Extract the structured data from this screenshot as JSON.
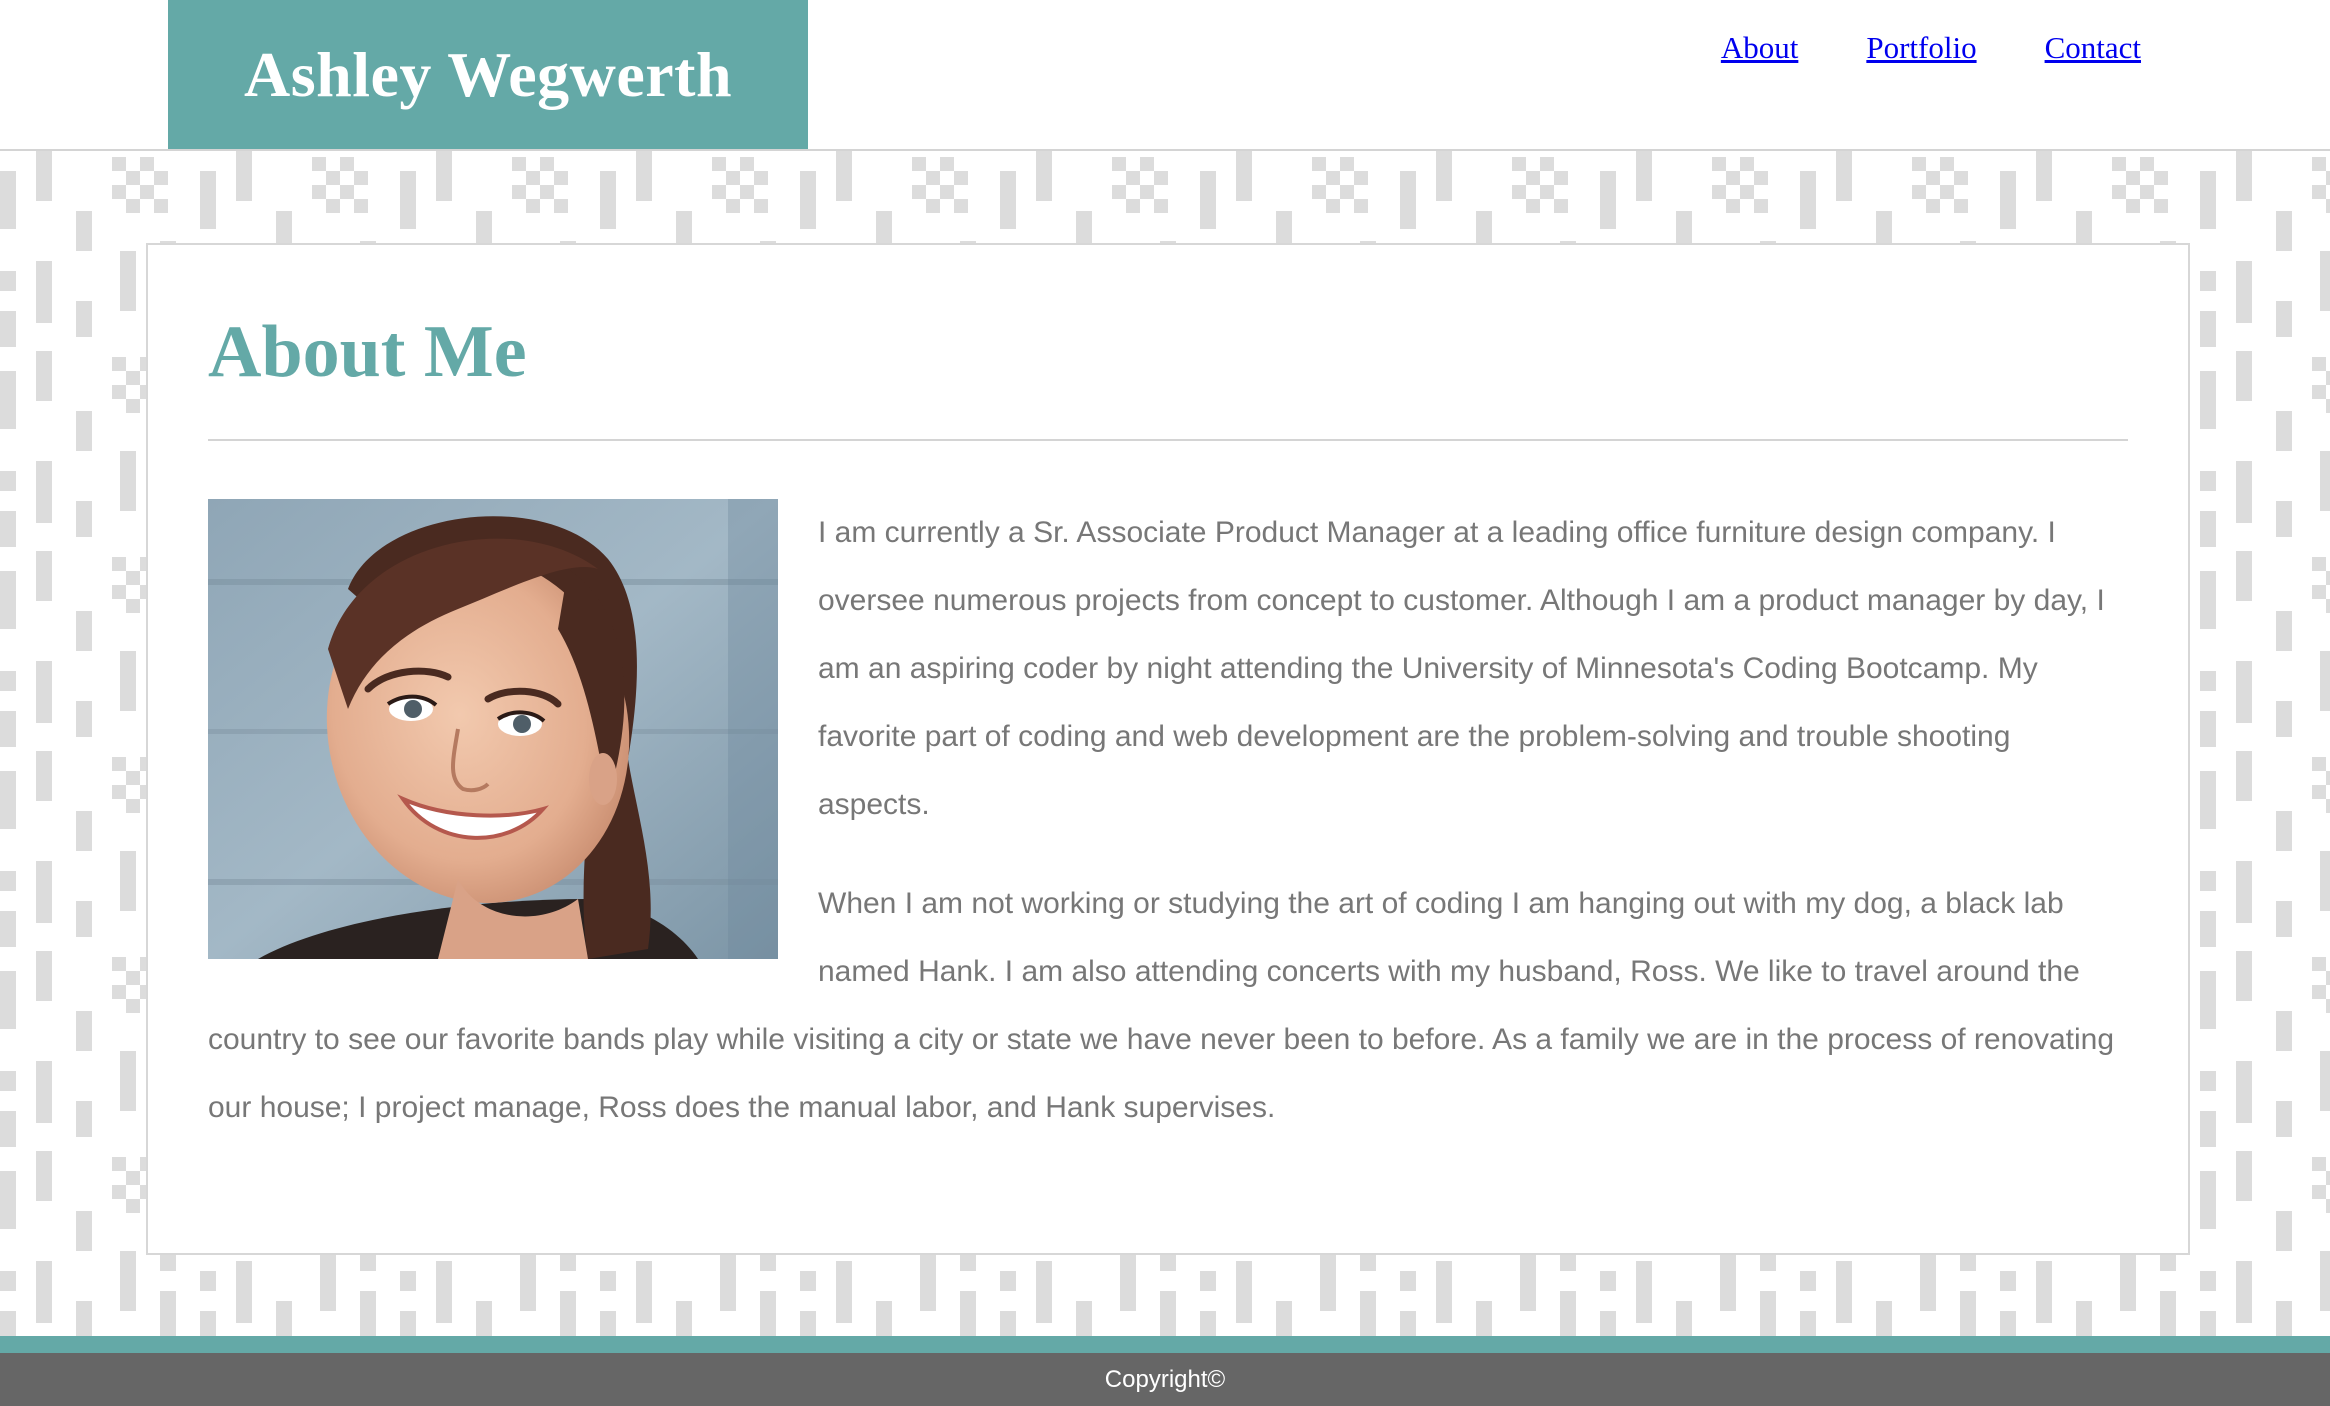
{
  "header": {
    "brand_name": "Ashley Wegwerth",
    "nav": [
      {
        "label": "About"
      },
      {
        "label": "Portfolio"
      },
      {
        "label": "Contact"
      }
    ]
  },
  "main": {
    "title": "About Me",
    "photo_alt": "Photo of Ashley Wegwerth",
    "paragraphs": [
      "I am currently a Sr. Associate Product Manager at a leading office furniture design company. I oversee numerous projects from concept to customer. Although I am a product manager by day, I am an aspiring coder by night attending the University of Minnesota's Coding Bootcamp. My favorite part of coding and web development are the problem-solving and trouble shooting aspects.",
      "When I am not working or studying the art of coding I am hanging out with my dog, a black lab named Hank. I am also attending concerts with my husband, Ross. We like to travel around the country to see our favorite bands play while visiting a city or state we have never been to before. As a family we are in the process of renovating our house; I project manage, Ross does the manual labor, and Hank supervises."
    ]
  },
  "footer": {
    "copyright": "Copyright©"
  },
  "colors": {
    "accent": "#64a9a7",
    "body_text": "#777777",
    "footer_bg": "#666666",
    "link": "#0000ee",
    "pattern": "#dcdcdc"
  },
  "icons": {
    "background": "geometric-pattern",
    "photo": "portrait-photo"
  }
}
